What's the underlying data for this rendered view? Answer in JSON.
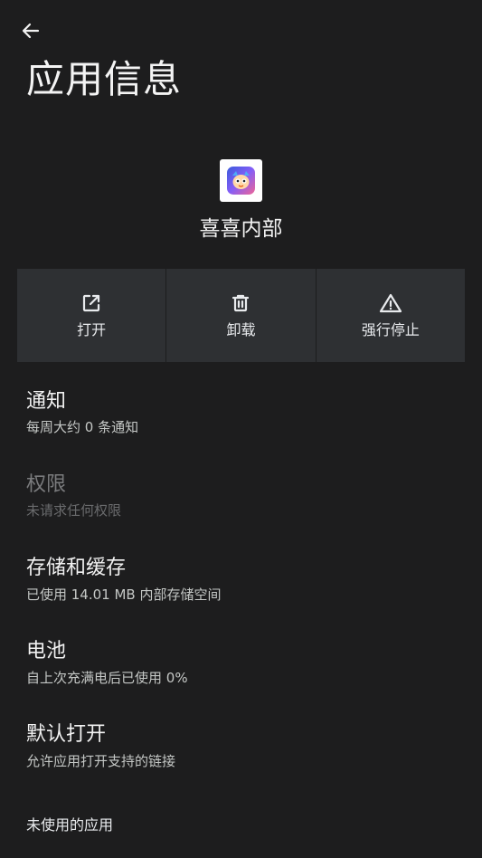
{
  "header": {
    "back_icon": "arrow-left-icon",
    "title": "应用信息"
  },
  "app": {
    "icon": "app-icon",
    "name": "喜喜内部"
  },
  "actions": [
    {
      "icon": "open-external-icon",
      "label": "打开"
    },
    {
      "icon": "trash-icon",
      "label": "卸载"
    },
    {
      "icon": "warning-icon",
      "label": "强行停止"
    }
  ],
  "items": [
    {
      "title": "通知",
      "summary": "每周大约 0 条通知",
      "enabled": true
    },
    {
      "title": "权限",
      "summary": "未请求任何权限",
      "enabled": false
    },
    {
      "title": "存储和缓存",
      "summary": "已使用 14.01 MB 内部存储空间",
      "enabled": true
    },
    {
      "title": "电池",
      "summary": "自上次充满电后已使用 0%",
      "enabled": true
    },
    {
      "title": "默认打开",
      "summary": "允许应用打开支持的链接",
      "enabled": true
    }
  ],
  "footer": {
    "label": "未使用的应用"
  },
  "colors": {
    "background": "#1d1d1e",
    "action_button": "#2e3033",
    "text_primary": "#f2f2f2",
    "text_secondary": "#c4c7c5",
    "text_disabled": "#7a7b7d"
  }
}
